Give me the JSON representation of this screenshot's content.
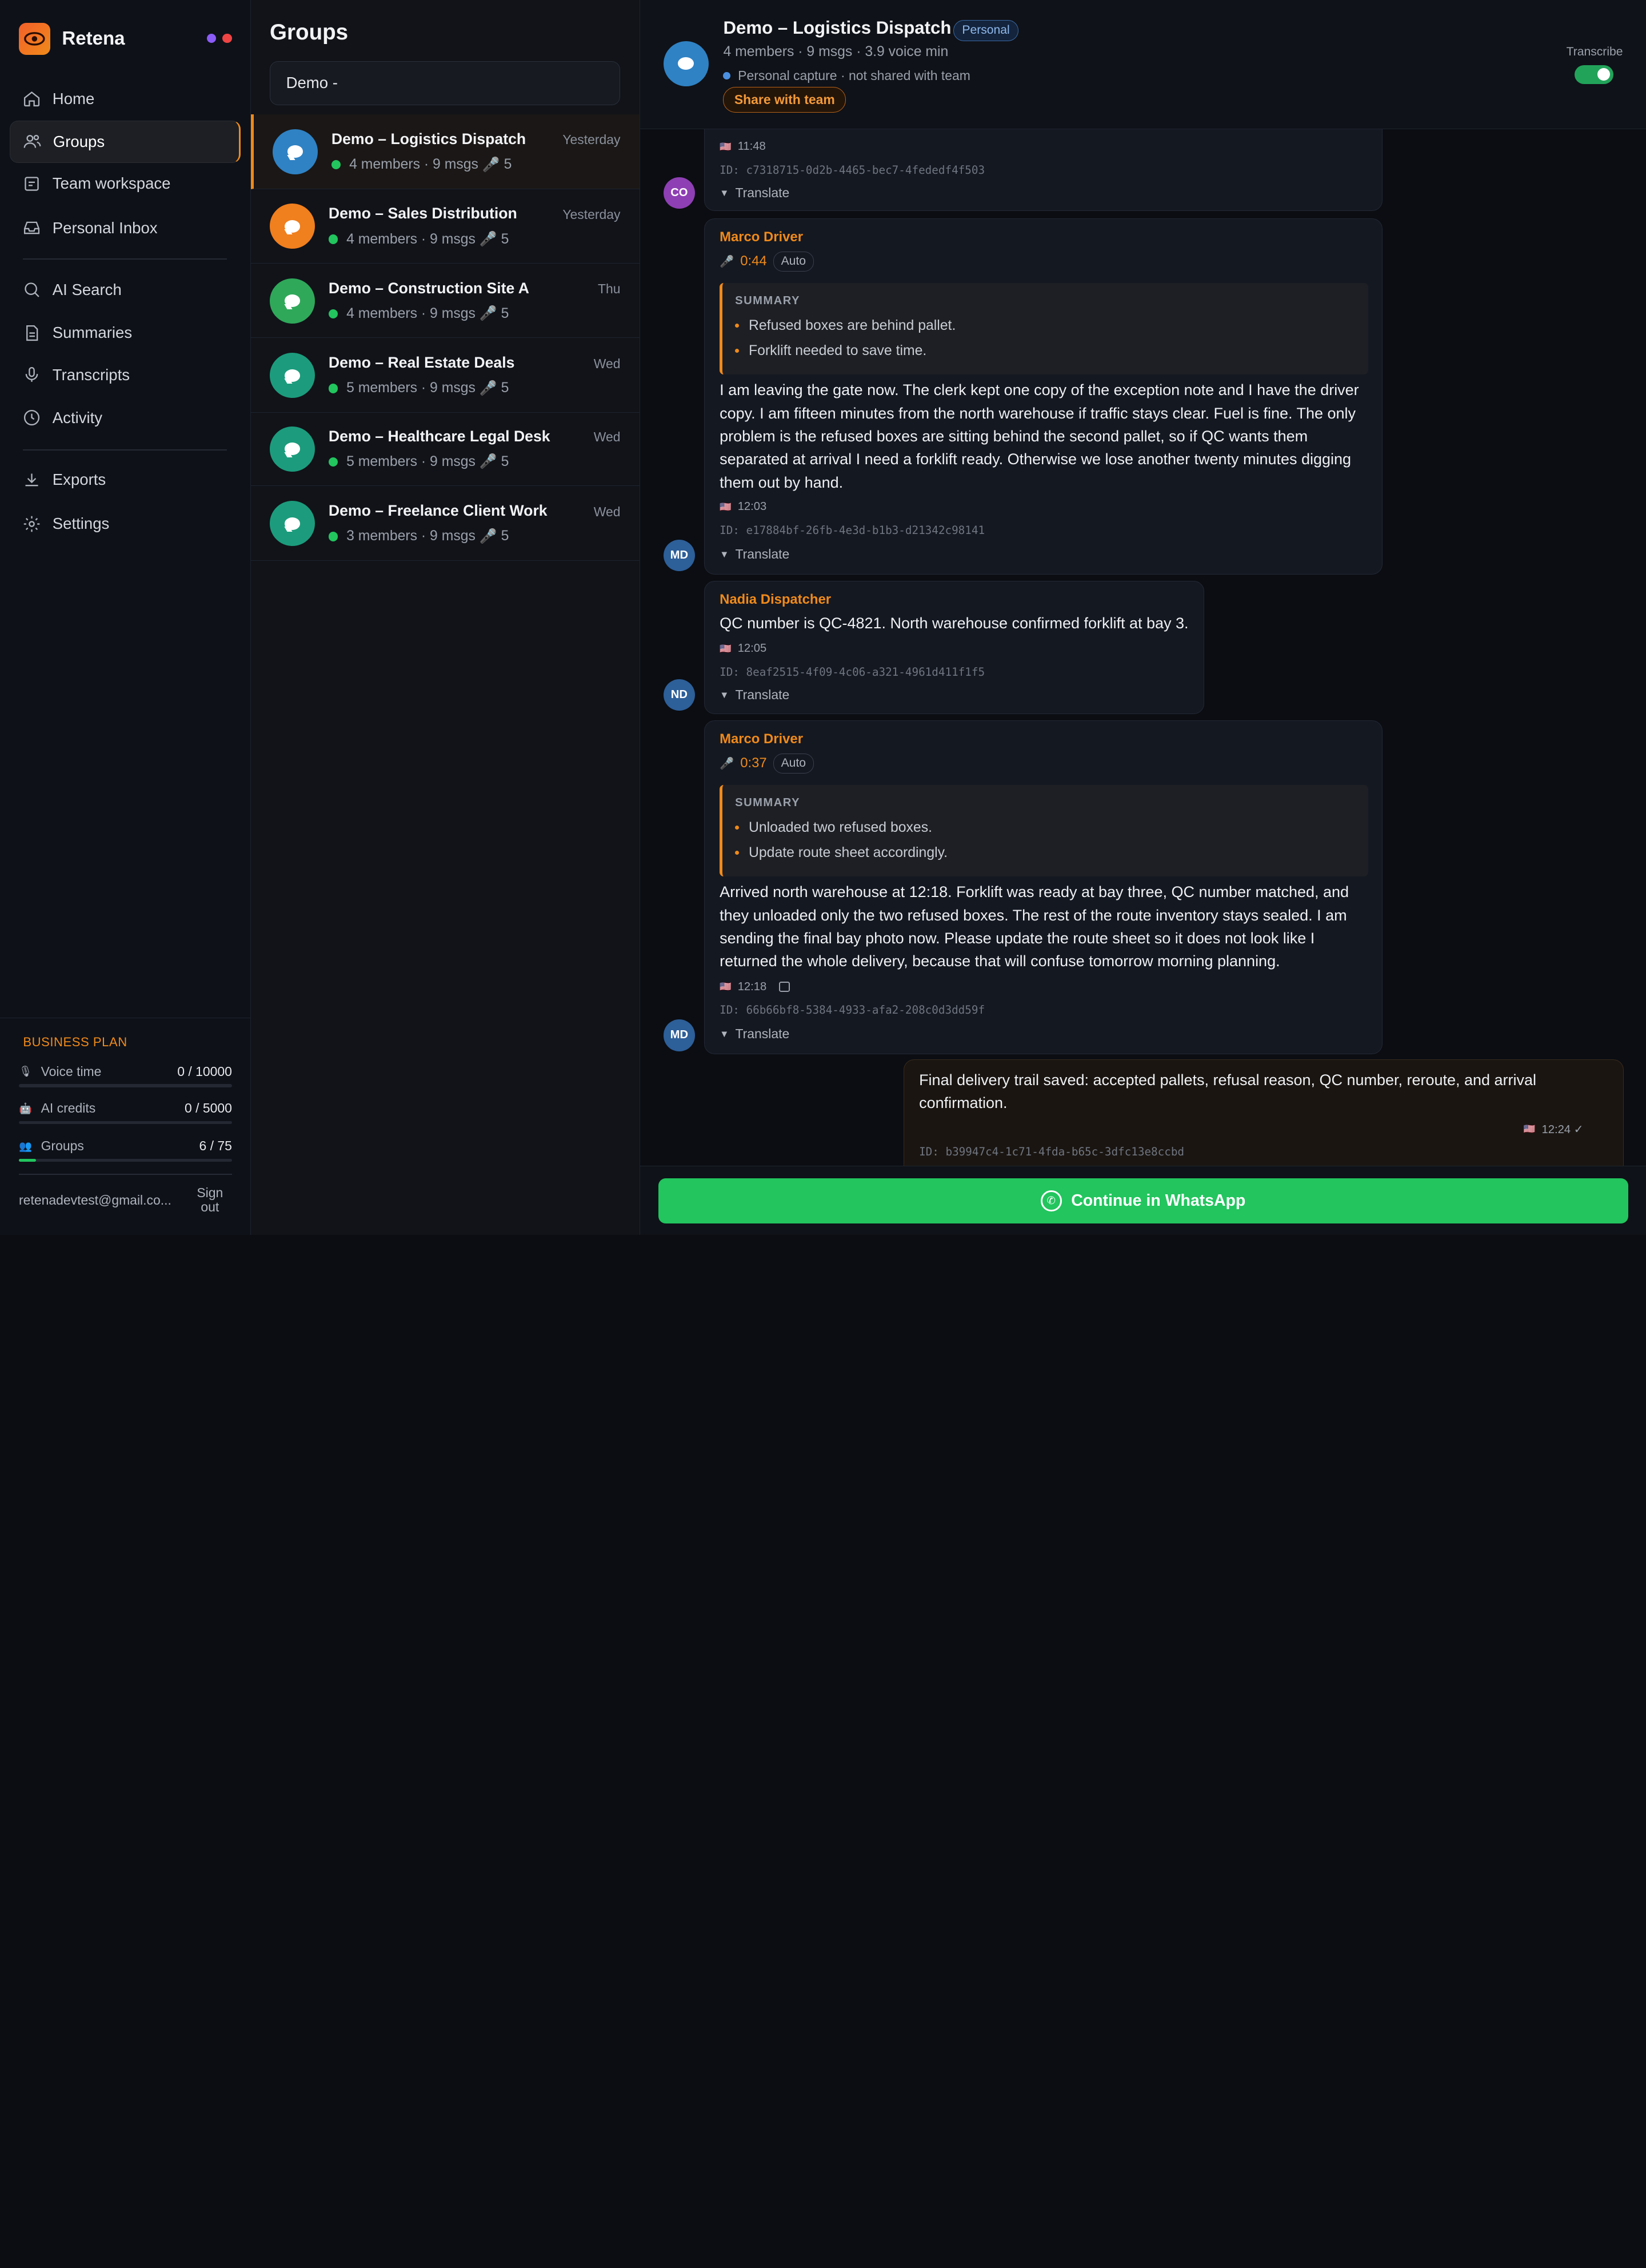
{
  "brand": {
    "name": "Retena",
    "dot_colors": [
      "#8b5cf6",
      "#ef4444"
    ]
  },
  "nav": {
    "home": "Home",
    "groups": "Groups",
    "team_workspace": "Team workspace",
    "personal_inbox": "Personal Inbox",
    "ai_search": "AI Search",
    "summaries": "Summaries",
    "transcripts": "Transcripts",
    "activity": "Activity",
    "exports": "Exports",
    "settings": "Settings"
  },
  "plan": {
    "title": "BUSINESS PLAN",
    "voice_label": "Voice time",
    "voice_value": "0 / 10000",
    "voice_fraction": 0,
    "ai_label": "AI credits",
    "ai_value": "0 / 5000",
    "ai_fraction": 0,
    "groups_label": "Groups",
    "groups_value": "6 / 75",
    "groups_fraction": 0.08
  },
  "account": {
    "email": "retenadevtest@gmail.co...",
    "signout": "Sign out"
  },
  "groups_panel": {
    "title": "Groups",
    "search_value": "Demo -",
    "items": [
      {
        "name": "Demo – Logistics Dispatch",
        "time": "Yesterday",
        "meta": "4 members · 9 msgs",
        "voice": "5",
        "color": "#2f82c4"
      },
      {
        "name": "Demo – Sales Distribution",
        "time": "Yesterday",
        "meta": "4 members · 9 msgs",
        "voice": "5",
        "color": "#f07f1e"
      },
      {
        "name": "Demo – Construction Site A",
        "time": "Thu",
        "meta": "4 members · 9 msgs",
        "voice": "5",
        "color": "#2fa85a"
      },
      {
        "name": "Demo – Real Estate Deals",
        "time": "Wed",
        "meta": "5 members · 9 msgs",
        "voice": "5",
        "color": "#1c9c7c"
      },
      {
        "name": "Demo – Healthcare Legal Desk",
        "time": "Wed",
        "meta": "5 members · 9 msgs",
        "voice": "5",
        "color": "#1c9c7c"
      },
      {
        "name": "Demo – Freelance Client Work",
        "time": "Wed",
        "meta": "3 members · 9 msgs",
        "voice": "5",
        "color": "#1c9c7c"
      }
    ]
  },
  "chat": {
    "title": "Demo – Logistics Dispatch",
    "badge": "Personal",
    "subtitle": "4 members · 9 msgs · 3.9 voice min",
    "capture": "Personal capture · not shared with team",
    "share": "Share with team",
    "transcribe_label": "Transcribe",
    "transcribe_on": true,
    "translate": "Translate",
    "summary_title": "SUMMARY",
    "auto": "Auto",
    "messages": [
      {
        "avatar": "CO",
        "avatar_color": "#8e3fb3",
        "time": "11:48",
        "id": "ID: c7318715-0d2b-4465-bec7-4fededf4f503"
      },
      {
        "avatar": "MD",
        "avatar_color": "#2d5f99",
        "sender": "Marco Driver",
        "duration": "0:44",
        "summary": [
          "Refused boxes are behind pallet.",
          "Forklift needed to save time."
        ],
        "body": "I am leaving the gate now. The clerk kept one copy of the exception note and I have the driver copy. I am fifteen minutes from the north warehouse if traffic stays clear. Fuel is fine. The only problem is the refused boxes are sitting behind the second pallet, so if QC wants them separated at arrival I need a forklift ready. Otherwise we lose another twenty minutes digging them out by hand.",
        "time": "12:03",
        "id": "ID: e17884bf-26fb-4e3d-b1b3-d21342c98141"
      },
      {
        "avatar": "ND",
        "avatar_color": "#2d5f99",
        "sender": "Nadia Dispatcher",
        "body": "QC number is QC-4821. North warehouse confirmed forklift at bay 3.",
        "time": "12:05",
        "id": "ID: 8eaf2515-4f09-4c06-a321-4961d411f1f5"
      },
      {
        "avatar": "MD",
        "avatar_color": "#2d5f99",
        "sender": "Marco Driver",
        "duration": "0:37",
        "summary": [
          "Unloaded two refused boxes.",
          "Update route sheet accordingly."
        ],
        "body": "Arrived north warehouse at 12:18. Forklift was ready at bay three, QC number matched, and they unloaded only the two refused boxes. The rest of the route inventory stays sealed. I am sending the final bay photo now. Please update the route sheet so it does not look like I returned the whole delivery, because that will confuse tomorrow morning planning.",
        "time": "12:18",
        "id": "ID: 66b66bf8-5384-4933-afa2-208c0d3dd59f"
      },
      {
        "own": true,
        "body": "Final delivery trail saved: accepted pallets, refusal reason, QC number, reroute, and arrival confirmation.",
        "time": "12:24 ✓",
        "id": "ID: b39947c4-1c71-4fda-b65c-3dfc13e8ccbd"
      }
    ]
  },
  "footer": {
    "whatsapp": "Continue in WhatsApp"
  },
  "colors": {
    "accent": "#f08a1a",
    "success": "#22c55e"
  }
}
